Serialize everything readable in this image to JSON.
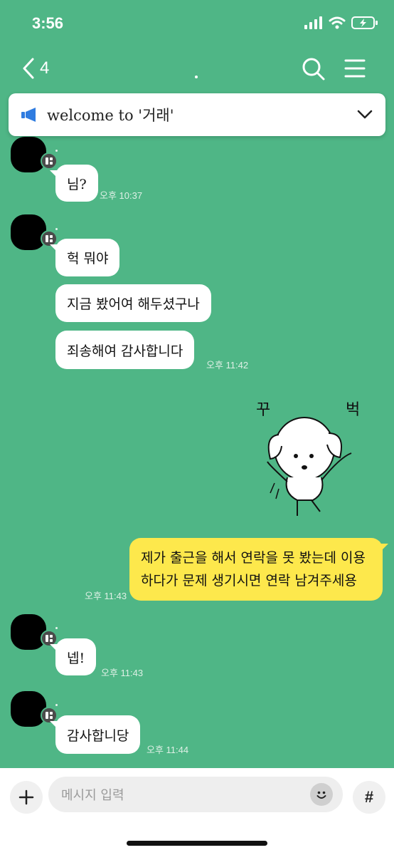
{
  "status_bar": {
    "time": "3:56"
  },
  "header": {
    "back_count": "4"
  },
  "notice": {
    "text": "welcome to '거래'"
  },
  "messages": [
    {
      "text": "님?",
      "time": "오후 10:37"
    },
    {
      "text": "헉 뭐야"
    },
    {
      "text": "지금 봤어여 해두셨구나"
    },
    {
      "text": "죄송해여 감사합니다",
      "time": "오후 11:42"
    },
    {
      "text": "제가 출근을 해서 연락을 못 봤는데 이용하다가 문제 생기시면 연락 남겨주세용",
      "time": "오후 11:43"
    },
    {
      "text": "넵!",
      "time": "오후 11:43"
    },
    {
      "text": "감사합니당",
      "time": "오후 11:44"
    }
  ],
  "sticker": {
    "text_left": "꾸",
    "text_right": "벅"
  },
  "input": {
    "placeholder": "메시지 입력",
    "hash": "#"
  },
  "colors": {
    "background": "#4fb686",
    "my_bubble": "#fde84c",
    "their_bubble": "#ffffff",
    "notice_icon": "#2f7ce0"
  }
}
